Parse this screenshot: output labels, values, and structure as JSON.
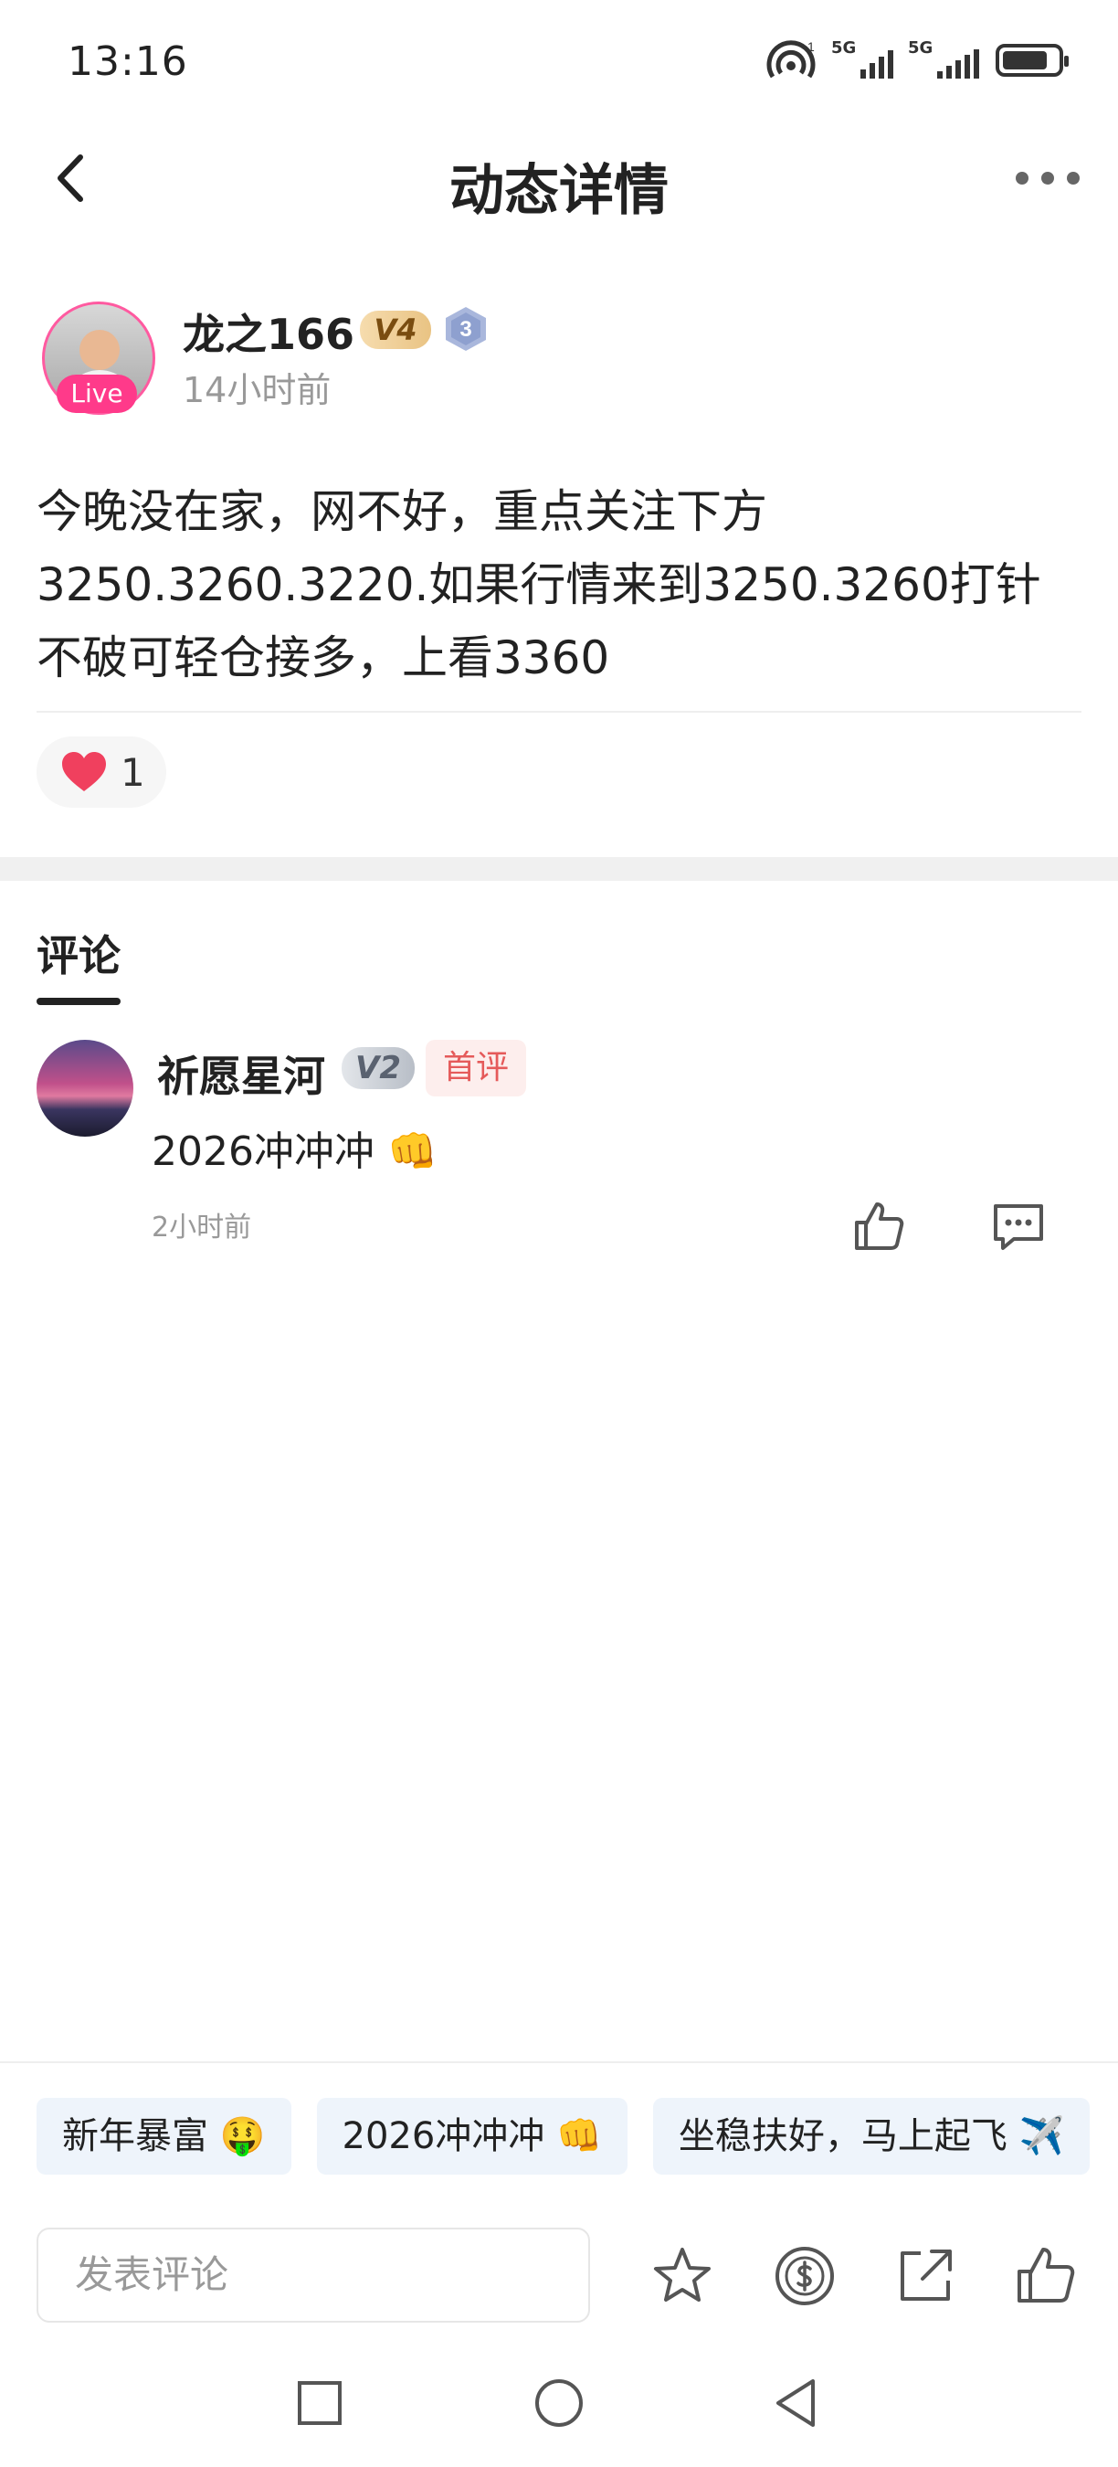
{
  "status_bar": {
    "time": "13:16",
    "net1": "5G",
    "net2": "5G",
    "sup": "1"
  },
  "header": {
    "title": "动态详情"
  },
  "author": {
    "name": "龙之166",
    "level_badge": "V4",
    "rank_number": "3",
    "live_label": "Live",
    "time": "14小时前"
  },
  "post": {
    "lines": [
      "今晚没在家，网不好，重点关注下方",
      "3250.3260.3220.如果行情来到3250.3260打针",
      "不破可轻仓接多，上看3360"
    ],
    "like_count": "1"
  },
  "comments_tab": {
    "label": "评论"
  },
  "comments": [
    {
      "name": "祈愿星河",
      "level_badge": "V2",
      "tag": "首评",
      "text": "2026冲冲冲 👊",
      "time": "2小时前"
    }
  ],
  "quick_replies": [
    "新年暴富 🤑",
    "2026冲冲冲 👊",
    "坐稳扶好，马上起飞 ✈️"
  ],
  "input": {
    "placeholder": "发表评论"
  },
  "colors": {
    "accent_pink": "#ff3a8a",
    "heart": "#f0405e",
    "chip_bg": "#eef4fb",
    "first_comment": "#e55a5a"
  }
}
